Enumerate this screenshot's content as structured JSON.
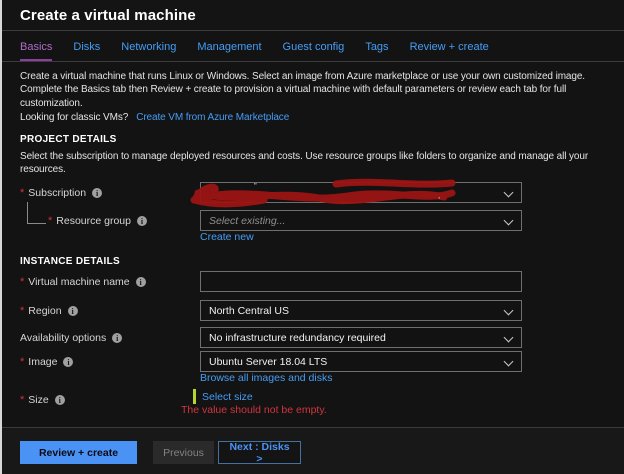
{
  "window": {
    "title": "Create a virtual machine"
  },
  "tabs": [
    {
      "label": "Basics",
      "active": true
    },
    {
      "label": "Disks",
      "active": false
    },
    {
      "label": "Networking",
      "active": false
    },
    {
      "label": "Management",
      "active": false
    },
    {
      "label": "Guest config",
      "active": false
    },
    {
      "label": "Tags",
      "active": false
    },
    {
      "label": "Review + create",
      "active": false
    }
  ],
  "intro": {
    "lines": [
      "Create a virtual machine that runs Linux or Windows. Select an image from Azure marketplace or use your own customized image.",
      "Complete the Basics tab then Review + create to provision a virtual machine with default parameters or review each tab for full",
      "customization."
    ],
    "classic_prompt": "Looking for classic VMs?",
    "classic_link": "Create VM from Azure Marketplace"
  },
  "icons": {
    "info": "i",
    "required_marker": "*"
  },
  "project_details": {
    "heading": "PROJECT DETAILS",
    "description_lines": [
      "Select the subscription to manage deployed resources and costs. Use resource groups like folders to organize and manage all your",
      "resources."
    ],
    "subscription": {
      "label": "Subscription",
      "required": true,
      "value_redacted": true
    },
    "resource_group": {
      "label": "Resource group",
      "required": true,
      "placeholder": "Select existing...",
      "create_link": "Create new"
    }
  },
  "instance_details": {
    "heading": "INSTANCE DETAILS",
    "vm_name": {
      "label": "Virtual machine name",
      "required": true,
      "value": ""
    },
    "region": {
      "label": "Region",
      "required": true,
      "value": "North Central US"
    },
    "availability": {
      "label": "Availability options",
      "required": false,
      "value": "No infrastructure redundancy required"
    },
    "image": {
      "label": "Image",
      "required": true,
      "value": "Ubuntu Server 18.04 LTS",
      "browse_link": "Browse all images and disks"
    },
    "size": {
      "label": "Size",
      "required": true,
      "select_link": "Select size",
      "error": "The value should not be empty."
    }
  },
  "redaction": {
    "fragments": [
      "”",
      ","
    ]
  },
  "footer": {
    "review_create": "Review + create",
    "previous": "Previous",
    "next": "Next : Disks >"
  },
  "colors": {
    "accent_blue": "#459df5",
    "active_tab_purple": "#ad6ec6",
    "tab_underline": "#8a3fa0",
    "error_red": "#d13440",
    "size_bar_green": "#b8d432",
    "primary_button_blue": "#4a93f5",
    "scribble_red": "#9c1414",
    "background": "#131313"
  }
}
